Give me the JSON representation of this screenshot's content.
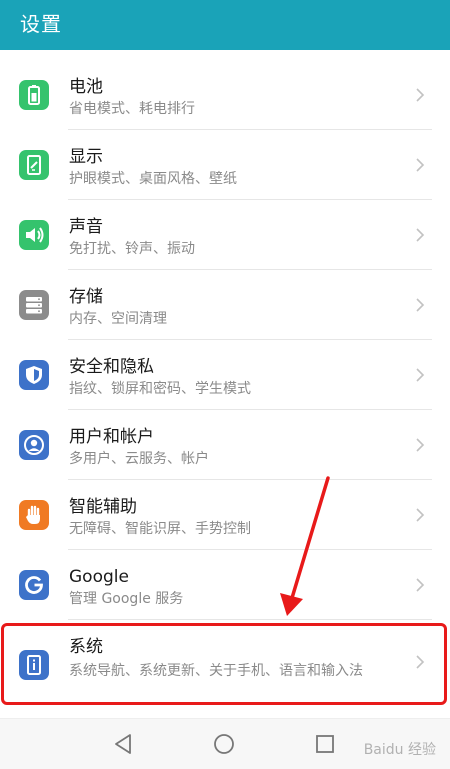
{
  "header": {
    "title": "设置"
  },
  "colors": {
    "header": "#1aa3b8",
    "highlight": "#e81a1a"
  },
  "items": [
    {
      "label": "电池",
      "subtitle": "省电模式、耗电排行",
      "icon": "battery-icon",
      "color": "#35c36d"
    },
    {
      "label": "显示",
      "subtitle": "护眼模式、桌面风格、壁纸",
      "icon": "display-icon",
      "color": "#35c36d"
    },
    {
      "label": "声音",
      "subtitle": "免打扰、铃声、振动",
      "icon": "sound-icon",
      "color": "#35c36d"
    },
    {
      "label": "存储",
      "subtitle": "内存、空间清理",
      "icon": "storage-icon",
      "color": "#8c8c8c"
    },
    {
      "label": "安全和隐私",
      "subtitle": "指纹、锁屏和密码、学生模式",
      "icon": "shield-icon",
      "color": "#3d72c9"
    },
    {
      "label": "用户和帐户",
      "subtitle": "多用户、云服务、帐户",
      "icon": "user-icon",
      "color": "#3d72c9"
    },
    {
      "label": "智能辅助",
      "subtitle": "无障碍、智能识屏、手势控制",
      "icon": "hand-icon",
      "color": "#f07a23"
    },
    {
      "label": "Google",
      "subtitle": "管理 Google 服务",
      "icon": "google-icon",
      "color": "#3d72c9"
    },
    {
      "label": "系统",
      "subtitle": "系统导航、系统更新、关于手机、语言和输入法",
      "icon": "system-info-icon",
      "color": "#3d72c9"
    }
  ],
  "navbar": {
    "back": "back-icon",
    "home": "home-icon",
    "recents": "recents-icon"
  },
  "watermark": "Baidu 经验"
}
